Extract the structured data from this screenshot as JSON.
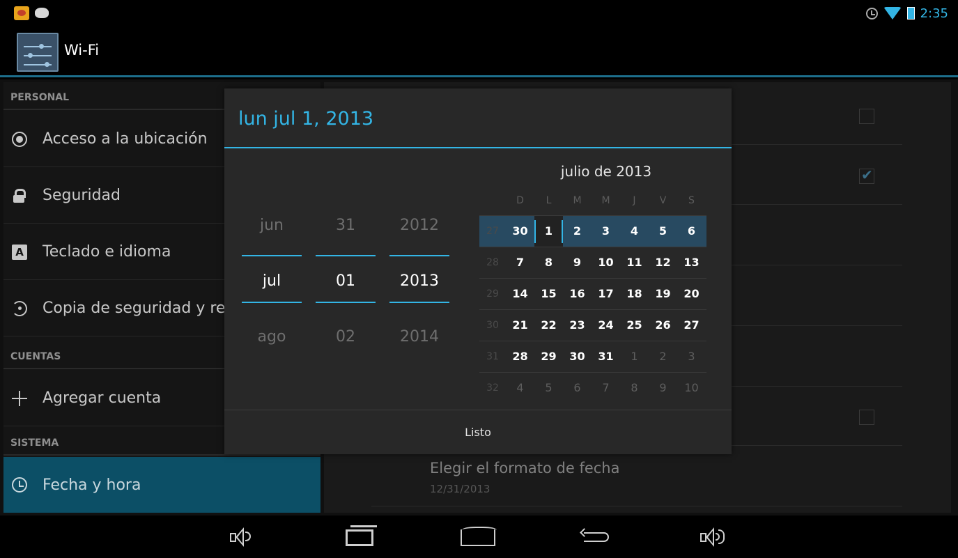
{
  "status_bar": {
    "time": "2:35"
  },
  "action_bar": {
    "title": "Wi-Fi"
  },
  "sidebar": {
    "sections": [
      {
        "header": "PERSONAL"
      },
      {
        "header": "CUENTAS"
      },
      {
        "header": "SISTEMA"
      }
    ],
    "items": [
      {
        "label": "Acceso a la ubicación",
        "icon": "location-icon"
      },
      {
        "label": "Seguridad",
        "icon": "lock-icon"
      },
      {
        "label": "Teclado e idioma",
        "icon": "keyboard-icon",
        "icon_glyph": "A"
      },
      {
        "label": "Copia de seguridad y restablecer",
        "icon": "restore-icon"
      },
      {
        "label": "Agregar cuenta",
        "icon": "plus-icon"
      },
      {
        "label": "Fecha y hora",
        "icon": "clock-icon",
        "selected": true
      }
    ]
  },
  "right_pane": {
    "date_format": {
      "title": "Elegir el formato de fecha",
      "summary": "12/31/2013"
    },
    "checkboxes": [
      false,
      true,
      false
    ]
  },
  "dialog": {
    "title": "lun jul 1, 2013",
    "spinners": {
      "month": {
        "prev": "jun",
        "current": "jul",
        "next": "ago"
      },
      "day": {
        "prev": "31",
        "current": "01",
        "next": "02"
      },
      "year": {
        "prev": "2012",
        "current": "2013",
        "next": "2014"
      }
    },
    "calendar": {
      "month_label": "julio de 2013",
      "weekdays": [
        "D",
        "L",
        "M",
        "M",
        "J",
        "V",
        "S"
      ],
      "weeks": [
        {
          "wk": "27",
          "days": [
            "30",
            "1",
            "2",
            "3",
            "4",
            "5",
            "6"
          ]
        },
        {
          "wk": "28",
          "days": [
            "7",
            "8",
            "9",
            "10",
            "11",
            "12",
            "13"
          ]
        },
        {
          "wk": "29",
          "days": [
            "14",
            "15",
            "16",
            "17",
            "18",
            "19",
            "20"
          ]
        },
        {
          "wk": "30",
          "days": [
            "21",
            "22",
            "23",
            "24",
            "25",
            "26",
            "27"
          ]
        },
        {
          "wk": "31",
          "days": [
            "28",
            "29",
            "30",
            "31",
            "1",
            "2",
            "3"
          ]
        },
        {
          "wk": "32",
          "days": [
            "4",
            "5",
            "6",
            "7",
            "8",
            "9",
            "10"
          ]
        }
      ],
      "selected_day": "1"
    },
    "done_label": "Listo"
  },
  "colors": {
    "accent": "#33b5e5",
    "selected_item": "#0c4f66",
    "week_highlight": "#284a61",
    "dialog_bg": "#282828"
  }
}
